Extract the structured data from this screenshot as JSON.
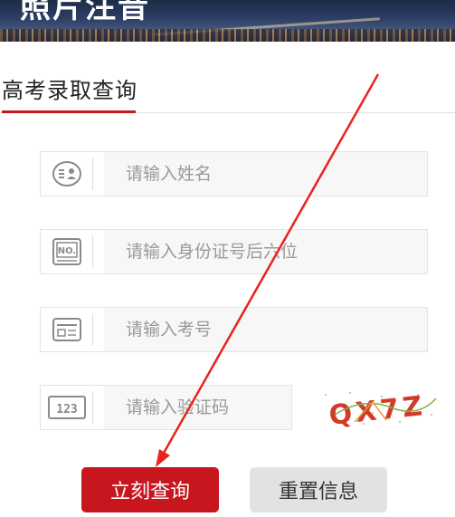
{
  "banner": {
    "title": "照片注音"
  },
  "section": {
    "title": "高考录取查询"
  },
  "form": {
    "name_placeholder": "请输入姓名",
    "id_placeholder": "请输入身份证号后六位",
    "exam_number_placeholder": "请输入考号",
    "captcha_placeholder": "请输入验证码",
    "icons": {
      "name": "person-card-icon",
      "id": "no-card-icon",
      "exam": "id-card-icon",
      "captcha": "number-123-icon"
    }
  },
  "captcha": {
    "text": "QX7Z"
  },
  "buttons": {
    "query_label": "立刻查询",
    "reset_label": "重置信息"
  },
  "colors": {
    "accent": "#c8161e",
    "annotation": "#e8231e"
  }
}
